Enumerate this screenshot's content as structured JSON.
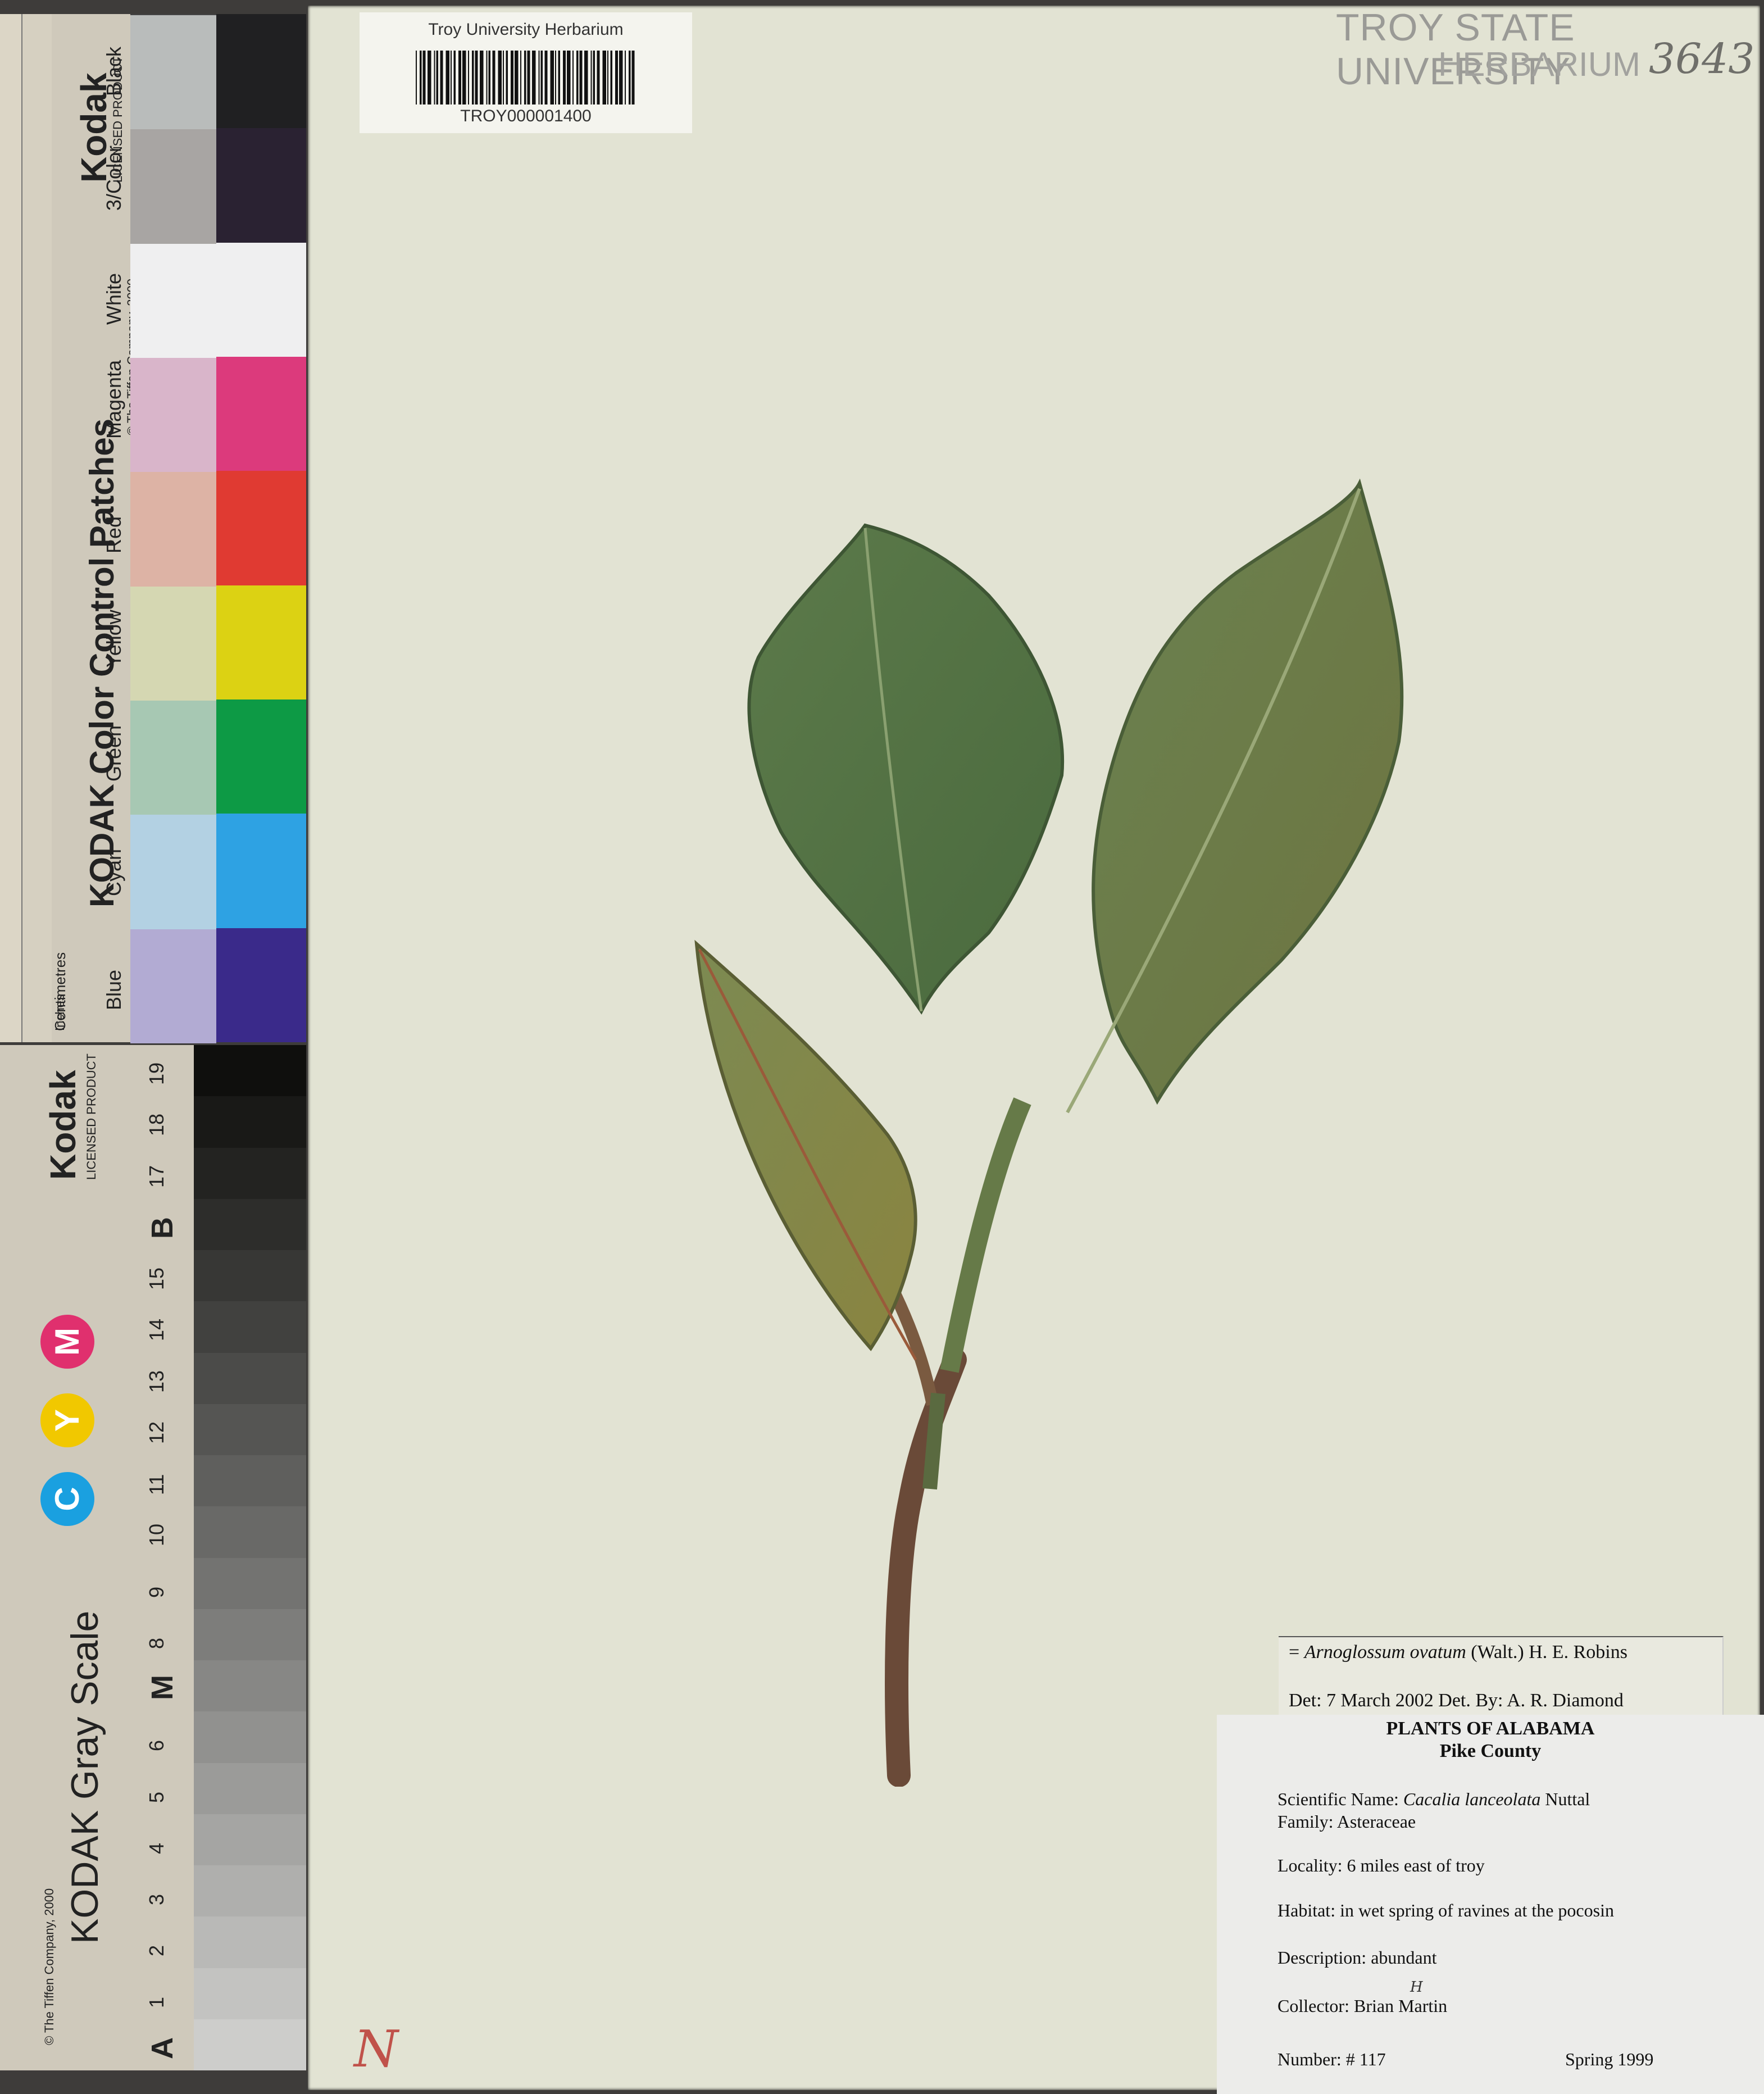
{
  "color_card": {
    "brand": "Kodak",
    "licensed": "LICENSED PRODUCT",
    "title": "KODAK Color Control Patches",
    "copyright": "© The Tiffen Company, 2000",
    "units_inches": "Inches",
    "units_cm": "Centimetres",
    "patch_labels": [
      "Blue",
      "Cyan",
      "Green",
      "Yellow",
      "Red",
      "Magenta",
      "White",
      "3/Color",
      "Black"
    ],
    "patch_colors_light": [
      "#b2abd3",
      "#b3d1e3",
      "#a7c8b3",
      "#d5d7b2",
      "#ddb3a5",
      "#d9b5ca",
      "#efeff0",
      "#a8a5a3",
      "#b9bcbb"
    ],
    "patch_colors_dark": [
      "#3a2a8a",
      "#2ea2e3",
      "#0d9a45",
      "#dcd213",
      "#e03a32",
      "#dc3a7c",
      "#efeff0",
      "#2a2232",
      "#202022"
    ]
  },
  "gray_card": {
    "brand": "Kodak",
    "licensed": "LICENSED PRODUCT",
    "title": "KODAK Gray Scale",
    "copyright": "© The Tiffen Company, 2000",
    "cym": [
      "C",
      "Y",
      "M"
    ],
    "cym_colors": [
      "#1aa0e0",
      "#f1c800",
      "#e0306e"
    ],
    "steps": [
      "A",
      "1",
      "2",
      "3",
      "4",
      "5",
      "6",
      "M",
      "8",
      "9",
      "10",
      "11",
      "12",
      "13",
      "14",
      "15",
      "B",
      "17",
      "18",
      "19"
    ]
  },
  "barcode": {
    "title": "Troy University Herbarium",
    "number": "TROY000001400"
  },
  "stamp": {
    "line1": "TROY STATE UNIVERSITY",
    "line2": "HERBARIUM",
    "accession": "3643"
  },
  "det_label": {
    "name_prefix": "= ",
    "name_italic": "Arnoglossum ovatum",
    "authority": " (Walt.) H. E. Robins",
    "det": "Det: 7 March 2002 Det. By: A. R. Diamond"
  },
  "main_label": {
    "title": "PLANTS OF ALABAMA",
    "county": "Pike County",
    "sci_prefix": "Scientific Name: ",
    "sci_italic": "Cacalia lanceolata",
    "sci_author": " Nuttal",
    "family": "Family: Asteraceae",
    "locality": "Locality: 6 miles east of troy",
    "habitat": "Habitat: in wet spring of ravines at the pocosin",
    "description": "Description: abundant",
    "collector": "Collector: Brian Martin",
    "collector_mark": "H",
    "number": "Number: # 117",
    "season": "Spring 1999"
  },
  "sheet_mark": "N"
}
